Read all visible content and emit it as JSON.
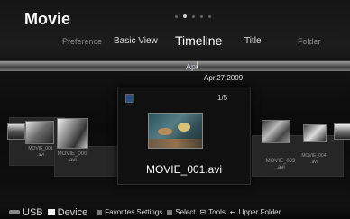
{
  "header": {
    "title": "Movie",
    "page_indicator": {
      "total": 5,
      "active_index": 1
    }
  },
  "tabs": [
    {
      "label": "Preference"
    },
    {
      "label": "Basic View"
    },
    {
      "label": "Timeline"
    },
    {
      "label": "Title"
    },
    {
      "label": "Folder"
    }
  ],
  "timeline": {
    "label": "Apr",
    "date": "Apr.27.2009"
  },
  "focused_item": {
    "counter": "1/5",
    "filename": "MOVIE_001.avi"
  },
  "side_items": [
    {
      "name": "MOVIE_001",
      "ext": ".avi"
    },
    {
      "name": "MOVIE_000",
      "ext": ".avi"
    },
    {
      "name": "MOVIE_003",
      "ext": ".avi"
    },
    {
      "name": "MOVIE_004",
      "ext": ".avi"
    }
  ],
  "footer": {
    "source": "USB",
    "device": "Device",
    "items": [
      {
        "label": "Favorites Settings",
        "color": "#7a7a7a"
      },
      {
        "label": "Select",
        "color": "#7a7a7a"
      },
      {
        "label": "Tools"
      },
      {
        "label": "Upper Folder"
      }
    ]
  }
}
